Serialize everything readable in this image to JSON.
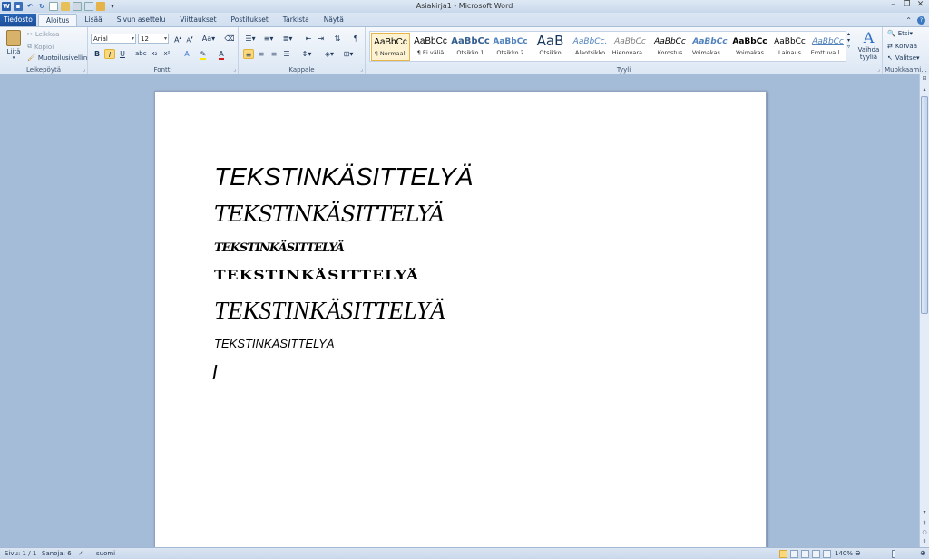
{
  "app": {
    "window_title": "Asiakirja1 - Microsoft Word"
  },
  "quick_access": {
    "icons": [
      "word-logo-icon",
      "save-icon",
      "undo-icon",
      "redo-icon",
      "new-document-icon",
      "open-icon",
      "print-preview-icon",
      "spelling-icon",
      "email-icon",
      "customize-qat-icon"
    ]
  },
  "tabs": [
    {
      "label": "Tiedosto"
    },
    {
      "label": "Aloitus"
    },
    {
      "label": "Lisää"
    },
    {
      "label": "Sivun asettelu"
    },
    {
      "label": "Viittaukset"
    },
    {
      "label": "Postitukset"
    },
    {
      "label": "Tarkista"
    },
    {
      "label": "Näytä"
    }
  ],
  "ribbon": {
    "clipboard": {
      "group_label": "Leikepöytä",
      "paste": "Liitä",
      "cut": "Leikkaa",
      "copy": "Kopioi",
      "format_painter": "Muotoilusivellin"
    },
    "font": {
      "group_label": "Fontti",
      "font_name": "Arial",
      "font_size": "12"
    },
    "paragraph": {
      "group_label": "Kappale"
    },
    "styles": {
      "group_label": "Tyyli",
      "items": [
        {
          "sample": "AaBbCc",
          "name": "¶ Normaali"
        },
        {
          "sample": "AaBbCc",
          "name": "¶ Ei väliä"
        },
        {
          "sample": "AaBbCc",
          "name": "Otsikko 1"
        },
        {
          "sample": "AaBbCc",
          "name": "Otsikko 2"
        },
        {
          "sample": "AaB",
          "name": "Otsikko"
        },
        {
          "sample": "AaBbCc.",
          "name": "Alaotsikko"
        },
        {
          "sample": "AaBbCc",
          "name": "Hienovara..."
        },
        {
          "sample": "AaBbCc",
          "name": "Korostus"
        },
        {
          "sample": "AaBbCc",
          "name": "Voimakas ..."
        },
        {
          "sample": "AaBbCc",
          "name": "Voimakas"
        },
        {
          "sample": "AaBbCc",
          "name": "Lainaus"
        },
        {
          "sample": "AaBbCc",
          "name": "Erottuva l..."
        }
      ],
      "change_styles": "Vaihda tyyliä"
    },
    "editing": {
      "group_label": "Muokkaami...",
      "find": "Etsi",
      "replace": "Korvaa",
      "select": "Valitse"
    }
  },
  "document": {
    "lines": [
      "TEKSTINKÄSITTELYÄ",
      "TEKSTINKÄSITTELYÄ",
      "TEKSTINKÄSITTELYÄ",
      "TEKSTINKÄSITTELYÄ",
      "TEKSTINKÄSITTELYÄ",
      "TEKSTINKÄSITTELYÄ"
    ]
  },
  "status": {
    "page": "Sivu: 1 / 1",
    "words": "Sanoja: 6",
    "language": "suomi",
    "zoom": "140%",
    "zoom_percent": 140
  }
}
